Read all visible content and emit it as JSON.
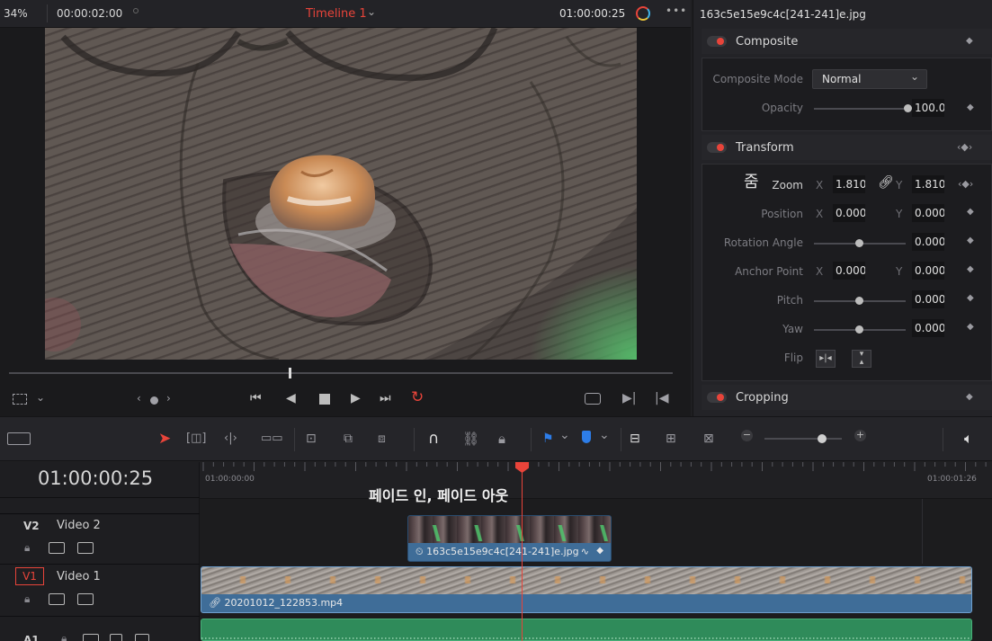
{
  "viewer": {
    "zoom": "34%",
    "source_timecode": "00:00:02:00",
    "timeline_name": "Timeline 1",
    "record_timecode": "01:00:00:25",
    "more": "•••"
  },
  "inspector": {
    "clip_name": "163c5e15e9c4c[241-241]e.jpg",
    "composite": {
      "title": "Composite",
      "mode_label": "Composite Mode",
      "mode_value": "Normal",
      "opacity_label": "Opacity",
      "opacity_value": "100.00",
      "opacity_level": 1.0
    },
    "transform": {
      "title": "Transform",
      "zoom_label": "Zoom",
      "zoom_korean": "줌",
      "zoom_x": "1.810",
      "zoom_y": "1.810",
      "position_label": "Position",
      "position_x": "0.000",
      "position_y": "0.000",
      "rotation_label": "Rotation Angle",
      "rotation_value": "0.000",
      "anchor_label": "Anchor Point",
      "anchor_x": "0.000",
      "anchor_y": "0.000",
      "pitch_label": "Pitch",
      "pitch_value": "0.000",
      "yaw_label": "Yaw",
      "yaw_value": "0.000",
      "flip_label": "Flip",
      "axis_x": "X",
      "axis_y": "Y"
    },
    "cropping": {
      "title": "Cropping"
    }
  },
  "timeline": {
    "current_timecode": "01:00:00:25",
    "ruler_start": "01:00:00:00",
    "ruler_end": "01:00:01:26",
    "overlay_title": "페이드 인, 페이드 아웃",
    "tracks": [
      {
        "id": "V2",
        "name": "Video 2"
      },
      {
        "id": "V1",
        "name": "Video 1"
      },
      {
        "id": "A1",
        "name": ""
      }
    ],
    "clips": {
      "v2_clip": "163c5e15e9c4c[241-241]e.jpg",
      "v1_clip": "20201012_122853.mp4"
    }
  },
  "colors": {
    "accent_red": "#e8443a",
    "video_clip": "#3f6d98",
    "audio_clip": "#2f8b5a",
    "playhead": "#e8443a"
  }
}
